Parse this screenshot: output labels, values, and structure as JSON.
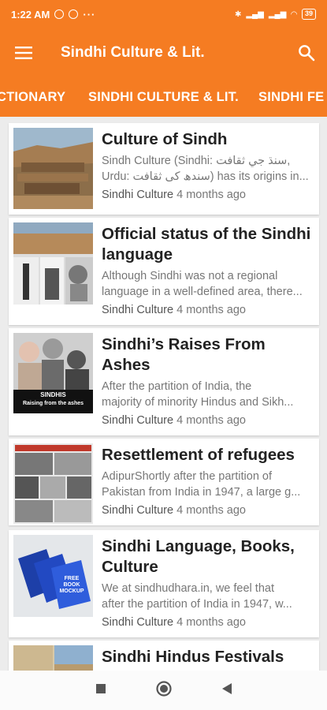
{
  "status_bar": {
    "time": "1:22 AM",
    "battery": "39"
  },
  "toolbar": {
    "title": "Sindhi Culture & Lit."
  },
  "tabs": [
    {
      "label": "CTIONARY"
    },
    {
      "label": "SINDHI CULTURE & LIT."
    },
    {
      "label": "SINDHI FE"
    }
  ],
  "posts": [
    {
      "title": "Culture of Sindh",
      "excerpt_l1": "Sindh Culture (Sindhi: سنڌ جي ثقافت,",
      "excerpt_l2": "Urdu: سندھ کی ثقافت) has its origins in...",
      "category": "Sindhi Culture",
      "time": "4 months ago"
    },
    {
      "title": "Official status of the Sindhi language",
      "excerpt_l1": "Although Sindhi was not a regional",
      "excerpt_l2": "language in a well-defined area, there...",
      "category": "Sindhi Culture",
      "time": "4 months ago"
    },
    {
      "title": "Sindhi’s Raises From Ashes",
      "excerpt_l1": "After the partition of India, the",
      "excerpt_l2": "majority of minority Hindus and Sikh...",
      "category": "Sindhi Culture",
      "time": "4 months ago",
      "thumb_caption_1": "SINDHIS",
      "thumb_caption_2": "Raising from the ashes"
    },
    {
      "title": "Resettlement of refugees",
      "excerpt_l1": "AdipurShortly after the partition of",
      "excerpt_l2": "Pakistan from India in 1947, a large g...",
      "category": "Sindhi Culture",
      "time": "4 months ago"
    },
    {
      "title": "Sindhi Language, Books, Culture",
      "excerpt_l1": "We at sindhudhara.in, we feel that",
      "excerpt_l2": "after the partition of India in 1947, w...",
      "category": "Sindhi Culture",
      "time": "4 months ago",
      "thumb_book_text": "FREE BOOK MOCKUP"
    },
    {
      "title": "Sindhi Hindus Festivals",
      "excerpt_l1": "",
      "excerpt_l2": "",
      "category": "",
      "time": ""
    }
  ],
  "colors": {
    "accent": "#f57c22",
    "background": "#ececec"
  },
  "icons": {
    "menu": "hamburger-menu-icon",
    "search": "search-icon",
    "nav_recent": "square-icon",
    "nav_home": "circle-icon",
    "nav_back": "back-triangle-icon"
  }
}
